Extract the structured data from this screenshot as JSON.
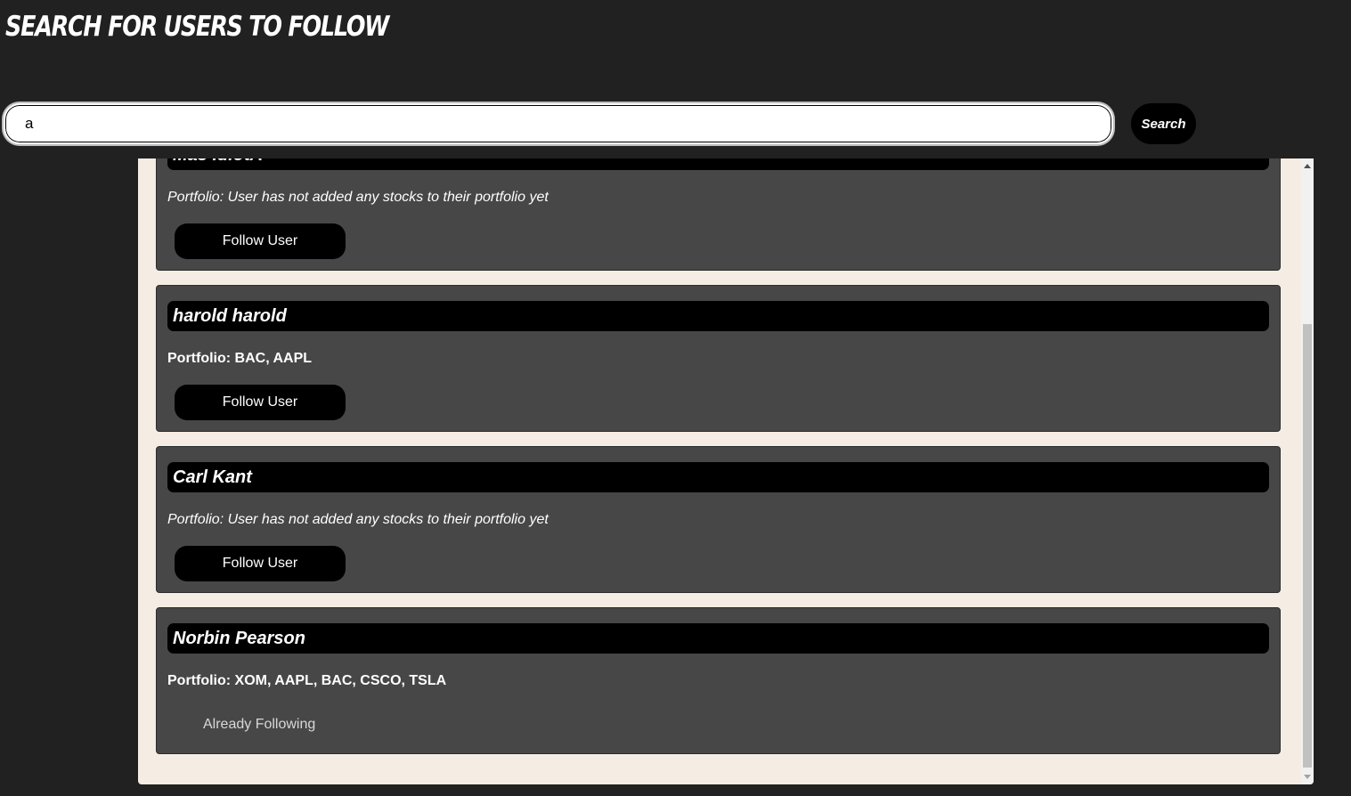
{
  "header": {
    "title": "Search for users to follow"
  },
  "search": {
    "value": "a",
    "placeholder": "",
    "button_label": "Search"
  },
  "results": [
    {
      "name": "Mas IdiotA",
      "portfolio": "Portfolio: User has not added any stocks to their portfolio yet",
      "has_stocks": false,
      "action": "Follow User",
      "following": false
    },
    {
      "name": "harold harold",
      "portfolio": "Portfolio: BAC, AAPL",
      "has_stocks": true,
      "action": "Follow User",
      "following": false
    },
    {
      "name": "Carl Kant",
      "portfolio": "Portfolio: User has not added any stocks to their portfolio yet",
      "has_stocks": false,
      "action": "Follow User",
      "following": false
    },
    {
      "name": "Norbin Pearson",
      "portfolio": "Portfolio: XOM, AAPL, BAC, CSCO, TSLA",
      "has_stocks": true,
      "action": "Already Following",
      "following": true
    }
  ],
  "colors": {
    "page_bg": "#212121",
    "panel_bg": "#f5ece3",
    "card_bg": "#474747",
    "name_bar": "#000000",
    "button_bg": "#000000",
    "text": "#ffffff"
  },
  "scroll": {
    "position_fraction": 0.28,
    "visible_fraction": 0.72
  }
}
